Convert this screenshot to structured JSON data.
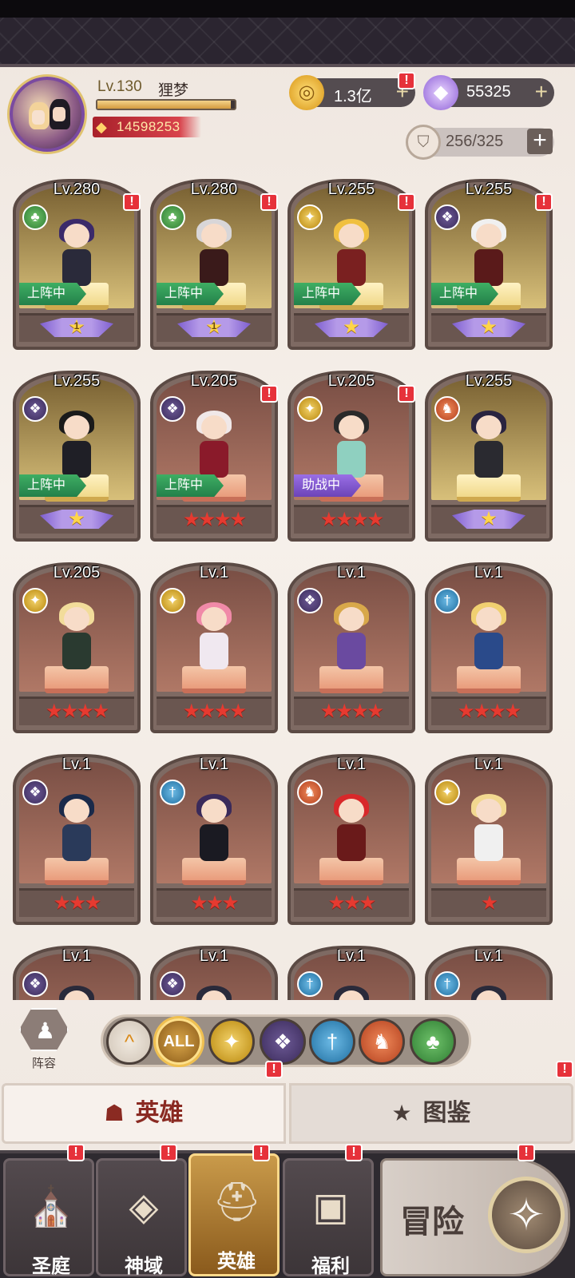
{
  "player": {
    "level_label": "Lv.130",
    "name": "狸梦",
    "exp_fraction": 0.97,
    "power": "14598253"
  },
  "resources": {
    "gold": "1.3亿",
    "gems": "55325",
    "bag": "256/325"
  },
  "badge_text": "!",
  "heroes": [
    {
      "lv": "Lv.280",
      "element": "nature",
      "bg": "gold",
      "tag": "上阵中",
      "tag_type": "active",
      "rank_type": "wing",
      "rank_num": "1",
      "stars": "",
      "badge": true,
      "hair": "#3b2a6a",
      "body": "#2a2a3a"
    },
    {
      "lv": "Lv.280",
      "element": "nature",
      "bg": "gold",
      "tag": "上阵中",
      "tag_type": "active",
      "rank_type": "wing",
      "rank_num": "1",
      "stars": "",
      "badge": true,
      "hair": "#d8d6d8",
      "body": "#3a1a1a"
    },
    {
      "lv": "Lv.255",
      "element": "light",
      "bg": "gold",
      "tag": "上阵中",
      "tag_type": "active",
      "rank_type": "wing",
      "rank_num": "",
      "stars": "",
      "badge": true,
      "hair": "#f0c040",
      "body": "#7a2020"
    },
    {
      "lv": "Lv.255",
      "element": "dark",
      "bg": "gold",
      "tag": "上阵中",
      "tag_type": "active",
      "rank_type": "wing",
      "rank_num": "",
      "stars": "",
      "badge": true,
      "hair": "#f0f0f0",
      "body": "#5a1a1a"
    },
    {
      "lv": "Lv.255",
      "element": "dark",
      "bg": "gold",
      "tag": "上阵中",
      "tag_type": "active",
      "rank_type": "wing",
      "rank_num": "",
      "stars": "",
      "badge": false,
      "hair": "#1a1a1a",
      "body": "#1f1f26"
    },
    {
      "lv": "Lv.205",
      "element": "dark",
      "bg": "red",
      "tag": "上阵中",
      "tag_type": "active",
      "rank_type": "stars",
      "rank_num": "",
      "stars": "★★★★",
      "badge": true,
      "hair": "#f0e8e8",
      "body": "#8a1a2a"
    },
    {
      "lv": "Lv.205",
      "element": "light",
      "bg": "red",
      "tag": "助战中",
      "tag_type": "assist",
      "rank_type": "stars",
      "rank_num": "",
      "stars": "★★★★",
      "badge": true,
      "hair": "#2a2a2a",
      "body": "#8fd0c0"
    },
    {
      "lv": "Lv.255",
      "element": "fire",
      "bg": "gold",
      "tag": "",
      "tag_type": "",
      "rank_type": "wing",
      "rank_num": "",
      "stars": "",
      "badge": false,
      "hair": "#2a2440",
      "body": "#2a2a30"
    },
    {
      "lv": "Lv.205",
      "element": "light",
      "bg": "red",
      "tag": "",
      "tag_type": "",
      "rank_type": "stars",
      "rank_num": "",
      "stars": "★★★★",
      "badge": false,
      "hair": "#f2dc9a",
      "body": "#2a3a30"
    },
    {
      "lv": "Lv.1",
      "element": "light",
      "bg": "red",
      "tag": "",
      "tag_type": "",
      "rank_type": "stars",
      "rank_num": "",
      "stars": "★★★★",
      "badge": false,
      "hair": "#f08aa8",
      "body": "#f0e8f0"
    },
    {
      "lv": "Lv.1",
      "element": "dark",
      "bg": "red",
      "tag": "",
      "tag_type": "",
      "rank_type": "stars",
      "rank_num": "",
      "stars": "★★★★",
      "badge": false,
      "hair": "#d8a84a",
      "body": "#6a4aa0"
    },
    {
      "lv": "Lv.1",
      "element": "water",
      "bg": "red",
      "tag": "",
      "tag_type": "",
      "rank_type": "stars",
      "rank_num": "",
      "stars": "★★★★",
      "badge": false,
      "hair": "#f0d070",
      "body": "#2a4a8a"
    },
    {
      "lv": "Lv.1",
      "element": "dark",
      "bg": "red",
      "tag": "",
      "tag_type": "",
      "rank_type": "stars",
      "rank_num": "",
      "stars": "★★★",
      "badge": false,
      "hair": "#1a2a4a",
      "body": "#2a3a5a"
    },
    {
      "lv": "Lv.1",
      "element": "water",
      "bg": "red",
      "tag": "",
      "tag_type": "",
      "rank_type": "stars",
      "rank_num": "",
      "stars": "★★★",
      "badge": false,
      "hair": "#3a2a5a",
      "body": "#1a1a22"
    },
    {
      "lv": "Lv.1",
      "element": "fire",
      "bg": "red",
      "tag": "",
      "tag_type": "",
      "rank_type": "stars",
      "rank_num": "",
      "stars": "★★★",
      "badge": false,
      "hair": "#d8282a",
      "body": "#6a1a1a"
    },
    {
      "lv": "Lv.1",
      "element": "light",
      "bg": "red",
      "tag": "",
      "tag_type": "",
      "rank_type": "stars",
      "rank_num": "",
      "stars": "★",
      "badge": false,
      "hair": "#f2d890",
      "body": "#f0f0f0"
    },
    {
      "lv": "Lv.1",
      "element": "dark",
      "bg": "red",
      "tag": "",
      "tag_type": "",
      "rank_type": "stars",
      "rank_num": "",
      "stars": "",
      "badge": false,
      "hair": "#2a2a3a",
      "body": "#2a2a3a"
    },
    {
      "lv": "Lv.1",
      "element": "dark",
      "bg": "red",
      "tag": "",
      "tag_type": "",
      "rank_type": "stars",
      "rank_num": "",
      "stars": "",
      "badge": false,
      "hair": "#2a2a3a",
      "body": "#2a2a3a"
    },
    {
      "lv": "Lv.1",
      "element": "water",
      "bg": "red",
      "tag": "",
      "tag_type": "",
      "rank_type": "stars",
      "rank_num": "",
      "stars": "",
      "badge": false,
      "hair": "#2a2a3a",
      "body": "#2a2a3a"
    },
    {
      "lv": "Lv.1",
      "element": "water",
      "bg": "red",
      "tag": "",
      "tag_type": "",
      "rank_type": "stars",
      "rank_num": "",
      "stars": "",
      "badge": false,
      "hair": "#2a2a3a",
      "body": "#2a2a3a"
    }
  ],
  "element_icons": {
    "light": "✦",
    "dark": "❖",
    "nature": "♣",
    "water": "†",
    "fire": "♞"
  },
  "formation_label": "阵容",
  "filters": {
    "up": "^",
    "all": "ALL",
    "light": "✦",
    "dark": "❖",
    "water": "†",
    "fire": "♞",
    "nature": "♣"
  },
  "tabs": {
    "hero": "英雄",
    "codex": "图鉴"
  },
  "nav": {
    "sanctuary": "圣庭",
    "divine": "神域",
    "heroes": "英雄",
    "welfare": "福利",
    "adventure": "冒险"
  }
}
